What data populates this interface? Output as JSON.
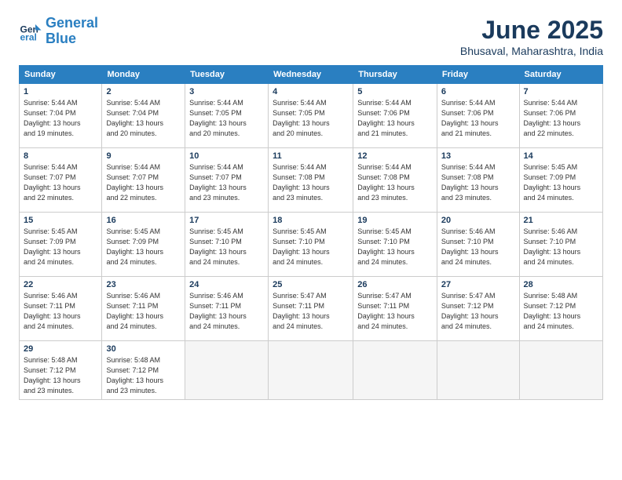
{
  "logo": {
    "line1": "General",
    "line2": "Blue"
  },
  "header": {
    "month": "June 2025",
    "location": "Bhusaval, Maharashtra, India"
  },
  "weekdays": [
    "Sunday",
    "Monday",
    "Tuesday",
    "Wednesday",
    "Thursday",
    "Friday",
    "Saturday"
  ],
  "weeks": [
    [
      {
        "day": "1",
        "sunrise": "5:44 AM",
        "sunset": "7:04 PM",
        "daylight": "13 hours and 19 minutes."
      },
      {
        "day": "2",
        "sunrise": "5:44 AM",
        "sunset": "7:04 PM",
        "daylight": "13 hours and 20 minutes."
      },
      {
        "day": "3",
        "sunrise": "5:44 AM",
        "sunset": "7:05 PM",
        "daylight": "13 hours and 20 minutes."
      },
      {
        "day": "4",
        "sunrise": "5:44 AM",
        "sunset": "7:05 PM",
        "daylight": "13 hours and 20 minutes."
      },
      {
        "day": "5",
        "sunrise": "5:44 AM",
        "sunset": "7:06 PM",
        "daylight": "13 hours and 21 minutes."
      },
      {
        "day": "6",
        "sunrise": "5:44 AM",
        "sunset": "7:06 PM",
        "daylight": "13 hours and 21 minutes."
      },
      {
        "day": "7",
        "sunrise": "5:44 AM",
        "sunset": "7:06 PM",
        "daylight": "13 hours and 22 minutes."
      }
    ],
    [
      {
        "day": "8",
        "sunrise": "5:44 AM",
        "sunset": "7:07 PM",
        "daylight": "13 hours and 22 minutes."
      },
      {
        "day": "9",
        "sunrise": "5:44 AM",
        "sunset": "7:07 PM",
        "daylight": "13 hours and 22 minutes."
      },
      {
        "day": "10",
        "sunrise": "5:44 AM",
        "sunset": "7:07 PM",
        "daylight": "13 hours and 23 minutes."
      },
      {
        "day": "11",
        "sunrise": "5:44 AM",
        "sunset": "7:08 PM",
        "daylight": "13 hours and 23 minutes."
      },
      {
        "day": "12",
        "sunrise": "5:44 AM",
        "sunset": "7:08 PM",
        "daylight": "13 hours and 23 minutes."
      },
      {
        "day": "13",
        "sunrise": "5:44 AM",
        "sunset": "7:08 PM",
        "daylight": "13 hours and 23 minutes."
      },
      {
        "day": "14",
        "sunrise": "5:45 AM",
        "sunset": "7:09 PM",
        "daylight": "13 hours and 24 minutes."
      }
    ],
    [
      {
        "day": "15",
        "sunrise": "5:45 AM",
        "sunset": "7:09 PM",
        "daylight": "13 hours and 24 minutes."
      },
      {
        "day": "16",
        "sunrise": "5:45 AM",
        "sunset": "7:09 PM",
        "daylight": "13 hours and 24 minutes."
      },
      {
        "day": "17",
        "sunrise": "5:45 AM",
        "sunset": "7:10 PM",
        "daylight": "13 hours and 24 minutes."
      },
      {
        "day": "18",
        "sunrise": "5:45 AM",
        "sunset": "7:10 PM",
        "daylight": "13 hours and 24 minutes."
      },
      {
        "day": "19",
        "sunrise": "5:45 AM",
        "sunset": "7:10 PM",
        "daylight": "13 hours and 24 minutes."
      },
      {
        "day": "20",
        "sunrise": "5:46 AM",
        "sunset": "7:10 PM",
        "daylight": "13 hours and 24 minutes."
      },
      {
        "day": "21",
        "sunrise": "5:46 AM",
        "sunset": "7:10 PM",
        "daylight": "13 hours and 24 minutes."
      }
    ],
    [
      {
        "day": "22",
        "sunrise": "5:46 AM",
        "sunset": "7:11 PM",
        "daylight": "13 hours and 24 minutes."
      },
      {
        "day": "23",
        "sunrise": "5:46 AM",
        "sunset": "7:11 PM",
        "daylight": "13 hours and 24 minutes."
      },
      {
        "day": "24",
        "sunrise": "5:46 AM",
        "sunset": "7:11 PM",
        "daylight": "13 hours and 24 minutes."
      },
      {
        "day": "25",
        "sunrise": "5:47 AM",
        "sunset": "7:11 PM",
        "daylight": "13 hours and 24 minutes."
      },
      {
        "day": "26",
        "sunrise": "5:47 AM",
        "sunset": "7:11 PM",
        "daylight": "13 hours and 24 minutes."
      },
      {
        "day": "27",
        "sunrise": "5:47 AM",
        "sunset": "7:12 PM",
        "daylight": "13 hours and 24 minutes."
      },
      {
        "day": "28",
        "sunrise": "5:48 AM",
        "sunset": "7:12 PM",
        "daylight": "13 hours and 24 minutes."
      }
    ],
    [
      {
        "day": "29",
        "sunrise": "5:48 AM",
        "sunset": "7:12 PM",
        "daylight": "13 hours and 23 minutes."
      },
      {
        "day": "30",
        "sunrise": "5:48 AM",
        "sunset": "7:12 PM",
        "daylight": "13 hours and 23 minutes."
      },
      null,
      null,
      null,
      null,
      null
    ]
  ],
  "labels": {
    "sunrise": "Sunrise:",
    "sunset": "Sunset:",
    "daylight": "Daylight:"
  }
}
